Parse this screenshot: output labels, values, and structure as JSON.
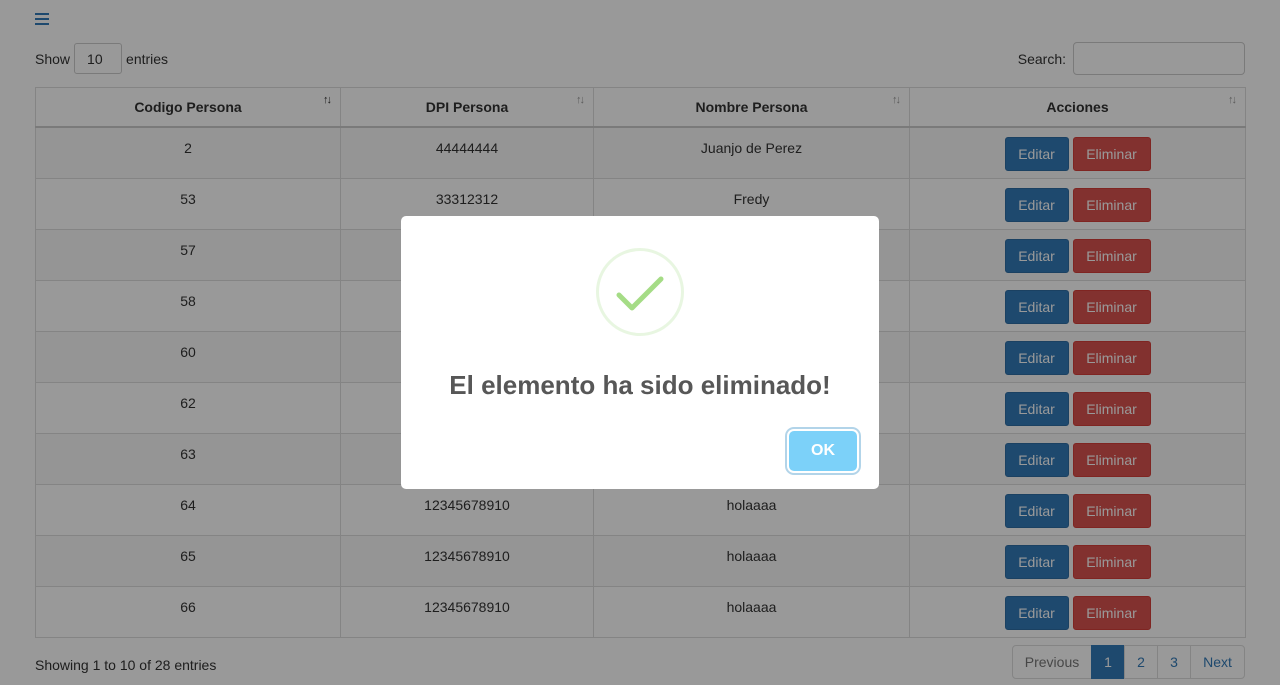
{
  "toolbar": {
    "menu_icon": "hamburger-icon"
  },
  "length": {
    "prefix": "Show",
    "value": "10",
    "suffix": "entries"
  },
  "search": {
    "label": "Search:",
    "value": ""
  },
  "table": {
    "headers": [
      "Codigo Persona",
      "DPI Persona",
      "Nombre Persona",
      "Acciones"
    ],
    "rows": [
      {
        "codigo": "2",
        "dpi": "44444444",
        "nombre": "Juanjo de Perez"
      },
      {
        "codigo": "53",
        "dpi": "33312312",
        "nombre": "Fredy"
      },
      {
        "codigo": "57",
        "dpi": "",
        "nombre": ""
      },
      {
        "codigo": "58",
        "dpi": "",
        "nombre": ""
      },
      {
        "codigo": "60",
        "dpi": "",
        "nombre": ""
      },
      {
        "codigo": "62",
        "dpi": "",
        "nombre": ""
      },
      {
        "codigo": "63",
        "dpi": "",
        "nombre": ""
      },
      {
        "codigo": "64",
        "dpi": "12345678910",
        "nombre": "holaaaa"
      },
      {
        "codigo": "65",
        "dpi": "12345678910",
        "nombre": "holaaaa"
      },
      {
        "codigo": "66",
        "dpi": "12345678910",
        "nombre": "holaaaa"
      }
    ],
    "edit_label": "Editar",
    "delete_label": "Eliminar"
  },
  "footer": {
    "info": "Showing 1 to 10 of 28 entries",
    "pagination": {
      "previous": "Previous",
      "pages": [
        "1",
        "2",
        "3"
      ],
      "current": "1",
      "next": "Next"
    }
  },
  "modal": {
    "icon": "success-check-icon",
    "title": "El elemento ha sido eliminado!",
    "ok_label": "OK"
  },
  "colors": {
    "primary": "#337ab7",
    "danger": "#d9534f",
    "ok_button": "#7cd1f9",
    "success_check": "#a5dc86"
  }
}
